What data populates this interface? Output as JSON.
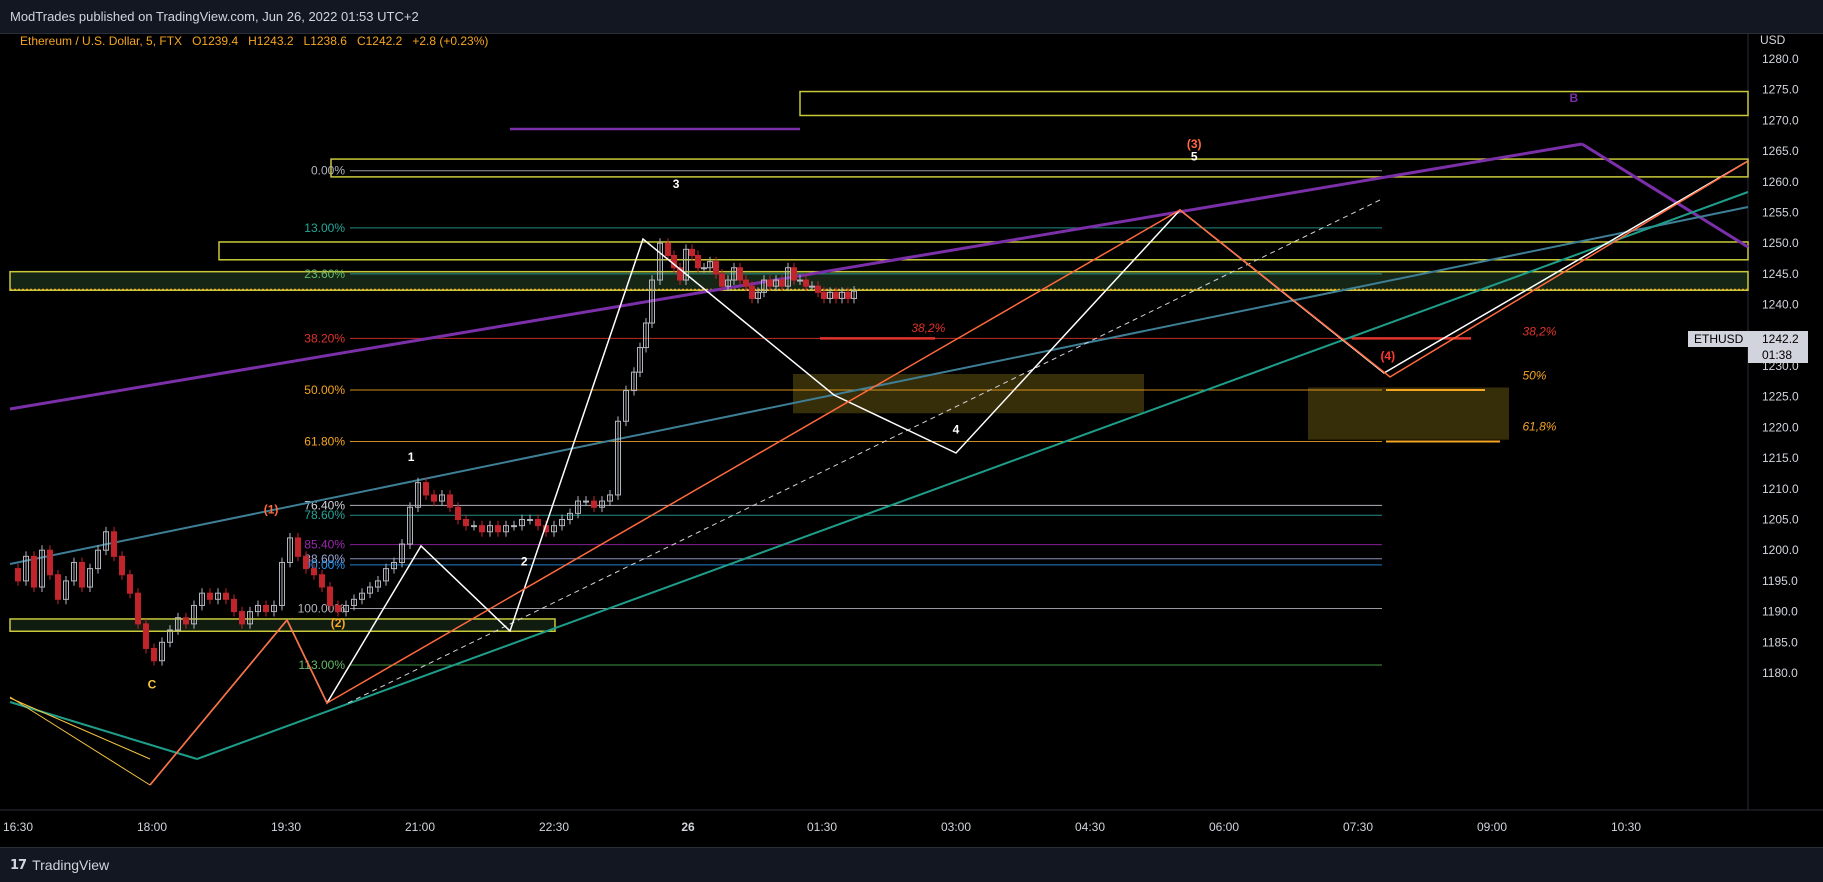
{
  "header": {
    "publisher_line": "ModTrades published on TradingView.com, Jun 26, 2022 01:53 UTC+2"
  },
  "legend": {
    "symbol": "Ethereum / U.S. Dollar, 5, FTX",
    "open": "O1239.4",
    "high": "H1243.2",
    "low": "L1238.6",
    "close": "C1242.2",
    "change": "+2.8 (+0.23%)"
  },
  "footer": {
    "brand": "TradingView",
    "brand_mark": "17"
  },
  "colors": {
    "background": "#000000",
    "up_candle": "#b2b5be",
    "down_candle": "#c2242c",
    "fib_orange": "#f5a623",
    "fib_red": "#e0342c",
    "fib_teal": "#26a69a",
    "purple": "#7b2fa8",
    "zone_yellow": "#c9c93a",
    "impulse_white": "#ffffff",
    "impulse_orange": "#ff6a3d"
  },
  "chart_data": {
    "type": "candlestick",
    "currency_label": "USD",
    "y_ticks": [
      "1280.0",
      "1275.0",
      "1270.0",
      "1265.0",
      "1260.0",
      "1255.0",
      "1250.0",
      "1245.0",
      "1240.0",
      "1235.0",
      "1230.0",
      "1225.0",
      "1220.0",
      "1215.0",
      "1210.0",
      "1205.0",
      "1200.0",
      "1195.0",
      "1190.0",
      "1185.0",
      "1180.0"
    ],
    "ylim": [
      1177.5,
      1282.5
    ],
    "x_ticks": [
      "16:30",
      "18:00",
      "19:30",
      "21:00",
      "22:30",
      "26",
      "01:30",
      "03:00",
      "04:30",
      "06:00",
      "07:30",
      "09:00",
      "10:30"
    ],
    "last_price": {
      "symbol": "ETHUSD",
      "price": "1242.2",
      "countdown": "01:38"
    },
    "fib_levels": [
      {
        "label": "0.00%",
        "value": 1261.8
      },
      {
        "label": "13.00%",
        "value": 1252.5
      },
      {
        "label": "23.60%",
        "value": 1245.0
      },
      {
        "label": "38.20%",
        "value": 1234.5
      },
      {
        "label": "50.00%",
        "value": 1226.1
      },
      {
        "label": "61.80%",
        "value": 1217.7
      },
      {
        "label": "76.40%",
        "value": 1207.3
      },
      {
        "label": "78.60%",
        "value": 1205.7
      },
      {
        "label": "85.40%",
        "value": 1200.9
      },
      {
        "label": "88.60%",
        "value": 1198.6
      },
      {
        "label": "90.00%",
        "value": 1197.6
      },
      {
        "label": "100.00%",
        "value": 1190.5
      },
      {
        "label": "113.00%",
        "value": 1181.3
      }
    ],
    "wave_labels": [
      {
        "text": "1",
        "time": "20:54",
        "value": 1214.5
      },
      {
        "text": "2",
        "time": "22:10",
        "value": 1197.5
      },
      {
        "text": "3",
        "time": "23:52",
        "value": 1259.0
      },
      {
        "text": "4",
        "time": "03:00",
        "value": 1219.0
      },
      {
        "text": "5",
        "time": "05:40",
        "value": 1263.5
      },
      {
        "text": "(1)",
        "time": "19:20",
        "value": 1206.0
      },
      {
        "text": "(2)",
        "time": "20:05",
        "value": 1187.5
      },
      {
        "text": "(3)",
        "time": "05:40",
        "value": 1265.5
      },
      {
        "text": "(4)",
        "time": "07:50",
        "value": 1231.0
      },
      {
        "text": "C",
        "time": "18:00",
        "value": 1177.5
      },
      {
        "text": "B",
        "time": "09:55",
        "value": 1273.0
      }
    ],
    "zone_labels": [
      {
        "text": "38,2%",
        "time": "02:30",
        "value": 1235.5
      },
      {
        "text": "38,2%",
        "time": "08:20",
        "value": 1235.0
      },
      {
        "text": "50%",
        "time": "08:20",
        "value": 1227.8
      },
      {
        "text": "61,8%",
        "time": "08:20",
        "value": 1219.5
      }
    ]
  }
}
